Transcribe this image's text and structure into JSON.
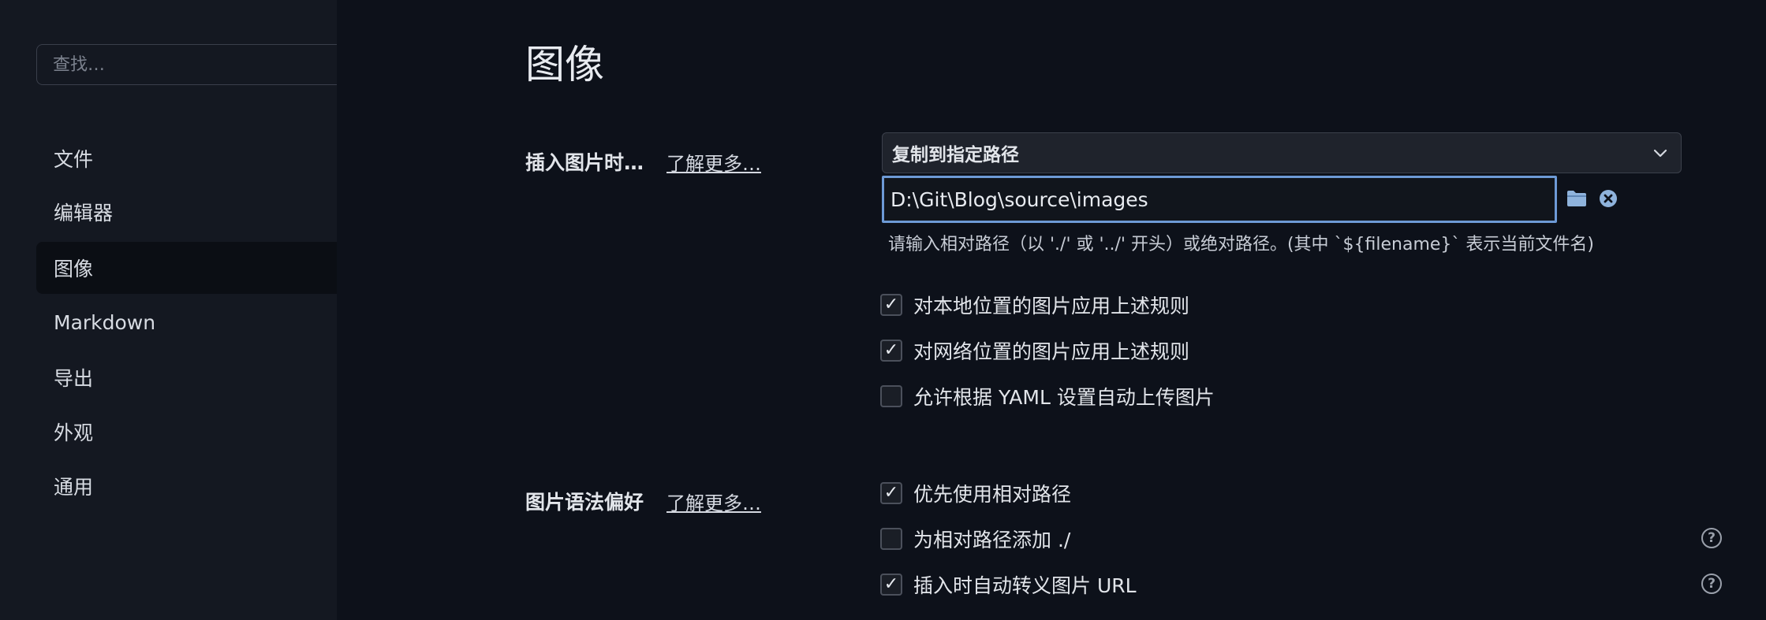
{
  "sidebar": {
    "search_placeholder": "查找…",
    "items": [
      {
        "label": "文件"
      },
      {
        "label": "编辑器"
      },
      {
        "label": "图像"
      },
      {
        "label": "Markdown"
      },
      {
        "label": "导出"
      },
      {
        "label": "外观"
      },
      {
        "label": "通用"
      }
    ],
    "active_index": 2
  },
  "main": {
    "title": "图像",
    "insert_section": {
      "label": "插入图片时…",
      "learn_more": "了解更多…",
      "action_select": "复制到指定路径",
      "path_value": "D:\\Git\\Blog\\source\\images",
      "hint": "请输入相对路径（以 './' 或 '../' 开头）或绝对路径。(其中 `${filename}` 表示当前文件名)",
      "options": [
        {
          "label": "对本地位置的图片应用上述规则",
          "checked": true
        },
        {
          "label": "对网络位置的图片应用上述规则",
          "checked": true
        },
        {
          "label": "允许根据 YAML 设置自动上传图片",
          "checked": false
        }
      ]
    },
    "syntax_section": {
      "label": "图片语法偏好",
      "learn_more": "了解更多…",
      "options": [
        {
          "label": "优先使用相对路径",
          "checked": true
        },
        {
          "label": "为相对路径添加 ./",
          "checked": false
        },
        {
          "label": "插入时自动转义图片 URL",
          "checked": true
        }
      ],
      "help_mark": "?"
    }
  },
  "colors": {
    "background": "#0d111a",
    "sidebar": "#141821",
    "active_item": "#0b0e14",
    "input_focus_border": "#6d9ad6",
    "folder_icon": "#8fb3dc"
  },
  "icons": [
    "folder-icon",
    "clear-icon",
    "chevron-down-icon",
    "help-icon"
  ]
}
